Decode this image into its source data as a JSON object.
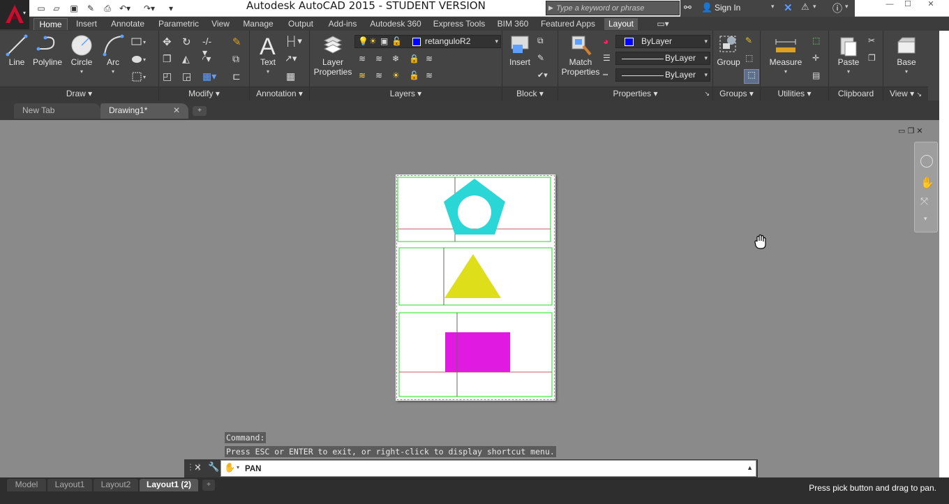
{
  "app": {
    "title": "Autodesk AutoCAD 2015 - STUDENT VERSION",
    "logo_icon": "autocad-a-icon",
    "accent_color": "#c8102e"
  },
  "quick_access": [
    "new-icon",
    "open-icon",
    "save-icon",
    "save-as-icon",
    "print-icon",
    "undo-icon",
    "redo-icon"
  ],
  "search": {
    "placeholder": "Type a keyword or phrase"
  },
  "account": {
    "sign_in": "Sign In"
  },
  "ribbon_tabs": [
    "Home",
    "Insert",
    "Annotate",
    "Parametric",
    "View",
    "Manage",
    "Output",
    "Add-ins",
    "Autodesk 360",
    "Express Tools",
    "BIM 360",
    "Featured Apps",
    "Layout"
  ],
  "ribbon_active_tab": "Home",
  "panels": {
    "draw": {
      "title": "Draw",
      "buttons": [
        "Line",
        "Polyline",
        "Circle",
        "Arc"
      ]
    },
    "modify": {
      "title": "Modify"
    },
    "annotation": {
      "title": "Annotation",
      "text": "Text"
    },
    "layers": {
      "title": "Layers",
      "layer_properties_1": "Layer",
      "layer_properties_2": "Properties",
      "current_layer": "retanguloR2",
      "current_layer_color": "#0000ff"
    },
    "block": {
      "title": "Block",
      "insert": "Insert"
    },
    "properties": {
      "title": "Properties",
      "match_1": "Match",
      "match_2": "Properties",
      "color": "ByLayer",
      "linetype": "ByLayer",
      "lineweight": "ByLayer"
    },
    "groups": {
      "title": "Groups",
      "group": "Group"
    },
    "utilities": {
      "title": "Utilities",
      "measure": "Measure"
    },
    "clipboard": {
      "title": "Clipboard",
      "paste": "Paste"
    },
    "view": {
      "title": "View",
      "base": "Base"
    }
  },
  "doc_tabs": [
    {
      "label": "New Tab"
    },
    {
      "label": "Drawing1*"
    }
  ],
  "drawing": {
    "pentagon_color": "#2ad6d6",
    "triangle_color": "#dede1a",
    "rectangle_color": "#e01ae0",
    "viewport_border_color": "#22dd22",
    "crosshair_color": "#c06060"
  },
  "command": {
    "history_1": "Command:",
    "history_2": "Press ESC or ENTER to exit, or right-click to display shortcut menu.",
    "input_value": "PAN"
  },
  "layout_tabs": [
    "Model",
    "Layout1",
    "Layout2",
    "Layout1 (2)"
  ],
  "layout_active": "Layout1 (2)",
  "status_message": "Press pick button and drag to pan."
}
